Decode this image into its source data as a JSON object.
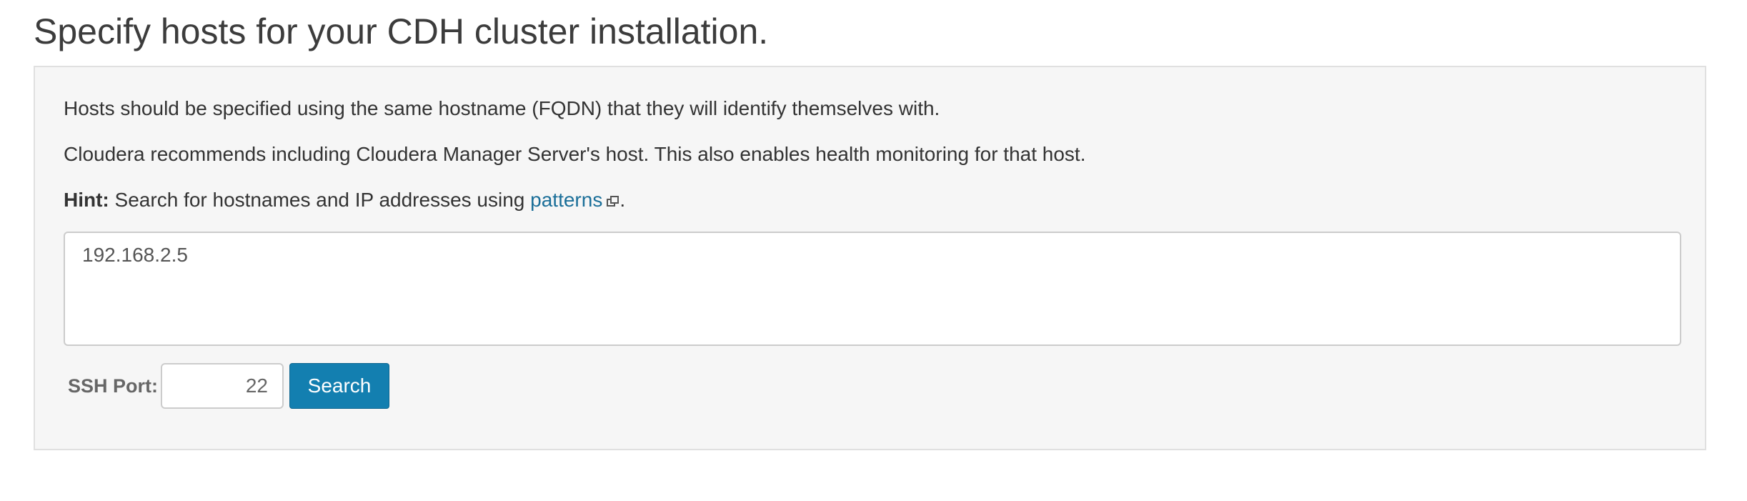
{
  "page": {
    "title": "Specify hosts for your CDH cluster installation."
  },
  "instructions": {
    "line1": "Hosts should be specified using the same hostname (FQDN) that they will identify themselves with.",
    "line2": "Cloudera recommends including Cloudera Manager Server's host. This also enables health monitoring for that host.",
    "hint_label": "Hint:",
    "hint_text": "Search for hostnames and IP addresses using",
    "hint_link": "patterns",
    "hint_end": "."
  },
  "hosts_input": {
    "value": "192.168.2.5"
  },
  "ssh": {
    "label": "SSH Port:",
    "port_value": "22"
  },
  "search_button": {
    "label": "Search"
  },
  "icons": {
    "external_link": "external-link-icon"
  },
  "colors": {
    "link": "#1b6f99",
    "button_bg": "#137fb0",
    "panel_bg": "#f6f6f6"
  }
}
